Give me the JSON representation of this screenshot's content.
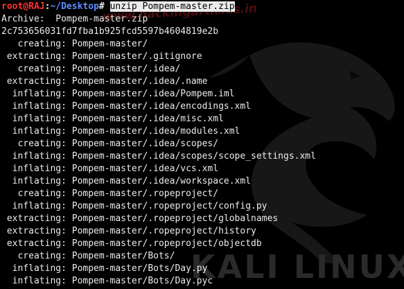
{
  "prompt": {
    "user_host": "root@RAJ",
    "separator": ":",
    "path": "~/Desktop",
    "symbol": "#",
    "command": "unzip Pompem-master.zip"
  },
  "output": [
    "Archive:  Pompem-master.zip",
    "2c753656031fd7fba1b925fcd5597b4604819e2b",
    "   creating: Pompem-master/",
    " extracting: Pompem-master/.gitignore",
    "   creating: Pompem-master/.idea/",
    " extracting: Pompem-master/.idea/.name",
    "  inflating: Pompem-master/.idea/Pompem.iml",
    "  inflating: Pompem-master/.idea/encodings.xml",
    "  inflating: Pompem-master/.idea/misc.xml",
    "  inflating: Pompem-master/.idea/modules.xml",
    "   creating: Pompem-master/.idea/scopes/",
    "  inflating: Pompem-master/.idea/scopes/scope_settings.xml",
    "  inflating: Pompem-master/.idea/vcs.xml",
    "  inflating: Pompem-master/.idea/workspace.xml",
    "   creating: Pompem-master/.ropeproject/",
    "  inflating: Pompem-master/.ropeproject/config.py",
    " extracting: Pompem-master/.ropeproject/globalnames",
    " extracting: Pompem-master/.ropeproject/history",
    " extracting: Pompem-master/.ropeproject/objectdb",
    "   creating: Pompem-master/Bots/",
    "  inflating: Pompem-master/Bots/Day.py",
    "  inflating: Pompem-master/Bots/Day.pyc"
  ],
  "watermark": {
    "site": "www.hackingarticles.in",
    "brand": "KALI LINUX"
  },
  "colors": {
    "background": "#000000",
    "text": "#ececec",
    "user": "#ff3030",
    "path": "#5c8cff"
  }
}
